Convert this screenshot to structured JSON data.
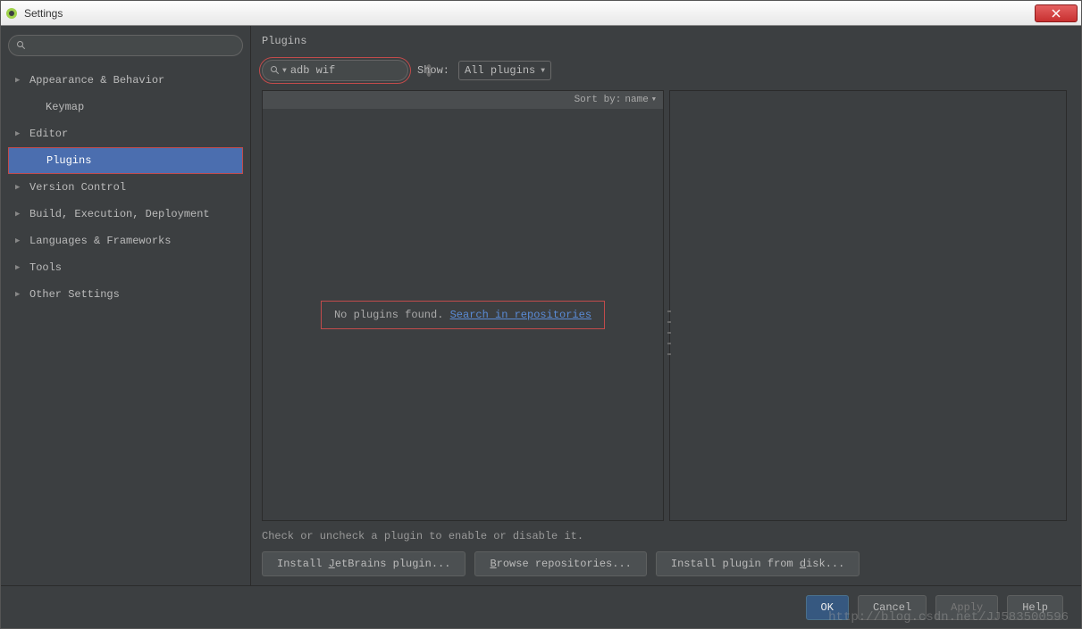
{
  "window": {
    "title": "Settings"
  },
  "sidebar": {
    "search_placeholder": "",
    "items": [
      {
        "label": "Appearance & Behavior",
        "expandable": true
      },
      {
        "label": "Keymap",
        "expandable": false
      },
      {
        "label": "Editor",
        "expandable": true
      },
      {
        "label": "Plugins",
        "expandable": false,
        "selected": true
      },
      {
        "label": "Version Control",
        "expandable": true
      },
      {
        "label": "Build, Execution, Deployment",
        "expandable": true
      },
      {
        "label": "Languages & Frameworks",
        "expandable": true
      },
      {
        "label": "Tools",
        "expandable": true
      },
      {
        "label": "Other Settings",
        "expandable": true
      }
    ]
  },
  "page": {
    "title": "Plugins",
    "search_value": "adb wif",
    "show_label": "Show:",
    "show_value": "All plugins",
    "sort_label": "Sort by:",
    "sort_value": "name",
    "empty_text": "No plugins found.",
    "empty_link": "Search in repositories",
    "hint": "Check or uncheck a plugin to enable or disable it.",
    "buttons": {
      "install_jb_pre": "Install ",
      "install_jb_u": "J",
      "install_jb_post": "etBrains plugin...",
      "browse_u": "B",
      "browse_post": "rowse repositories...",
      "disk_pre": "Install plugin from ",
      "disk_u": "d",
      "disk_post": "isk..."
    }
  },
  "footer": {
    "ok": "OK",
    "cancel": "Cancel",
    "apply": "Apply",
    "help": "Help"
  },
  "watermark": "http://blog.csdn.net/JJ583500596"
}
